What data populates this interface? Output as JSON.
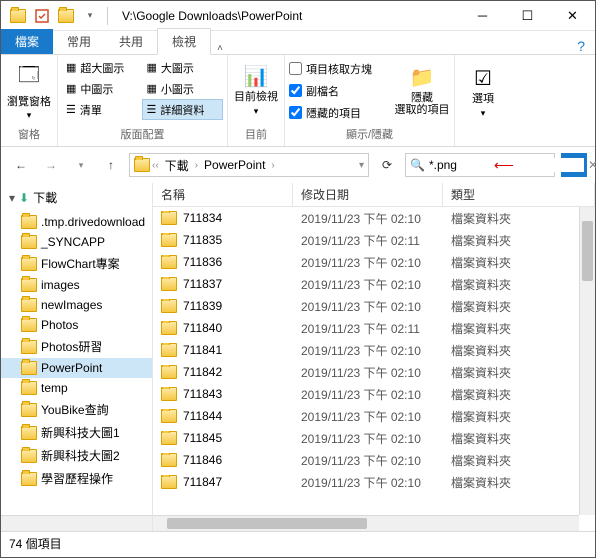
{
  "title": "V:\\Google Downloads\\PowerPoint",
  "tabs": {
    "file": "檔案",
    "home": "常用",
    "share": "共用",
    "view": "檢視"
  },
  "ribbon": {
    "panes": {
      "nav_pane": "瀏覽窗格",
      "group": "窗格"
    },
    "layout": {
      "extra_large": "超大圖示",
      "large": "大圖示",
      "medium": "中圖示",
      "small": "小圖示",
      "list": "清單",
      "details": "詳細資料",
      "group": "版面配置"
    },
    "current_view": {
      "sort": "目前檢視",
      "group": "目前"
    },
    "show_hide": {
      "item_check": "項目核取方塊",
      "ext": "副檔名",
      "hidden": "隱藏的項目",
      "hide_btn": "隱藏",
      "hide_btn2": "選取的項目",
      "group": "顯示/隱藏"
    },
    "options": {
      "label": "選項"
    }
  },
  "breadcrumb": {
    "item1": "下載",
    "item2": "PowerPoint"
  },
  "search": {
    "placeholder": "",
    "value": "*.png"
  },
  "nav_header": "下載",
  "nav_items": [
    ".tmp.drivedownload",
    "_SYNCAPP",
    "FlowChart專案",
    "images",
    "newImages",
    "Photos",
    "Photos研習",
    "PowerPoint",
    "temp",
    "YouBike查詢",
    "新興科技大圖1",
    "新興科技大圖2",
    "學習歷程操作"
  ],
  "nav_selected": 7,
  "columns": {
    "name": "名稱",
    "date": "修改日期",
    "type": "類型"
  },
  "files": [
    {
      "name": "711834",
      "date": "2019/11/23 下午 02:10",
      "type": "檔案資料夾"
    },
    {
      "name": "711835",
      "date": "2019/11/23 下午 02:11",
      "type": "檔案資料夾"
    },
    {
      "name": "711836",
      "date": "2019/11/23 下午 02:10",
      "type": "檔案資料夾"
    },
    {
      "name": "711837",
      "date": "2019/11/23 下午 02:10",
      "type": "檔案資料夾"
    },
    {
      "name": "711839",
      "date": "2019/11/23 下午 02:10",
      "type": "檔案資料夾"
    },
    {
      "name": "711840",
      "date": "2019/11/23 下午 02:11",
      "type": "檔案資料夾"
    },
    {
      "name": "711841",
      "date": "2019/11/23 下午 02:10",
      "type": "檔案資料夾"
    },
    {
      "name": "711842",
      "date": "2019/11/23 下午 02:10",
      "type": "檔案資料夾"
    },
    {
      "name": "711843",
      "date": "2019/11/23 下午 02:10",
      "type": "檔案資料夾"
    },
    {
      "name": "711844",
      "date": "2019/11/23 下午 02:10",
      "type": "檔案資料夾"
    },
    {
      "name": "711845",
      "date": "2019/11/23 下午 02:10",
      "type": "檔案資料夾"
    },
    {
      "name": "711846",
      "date": "2019/11/23 下午 02:10",
      "type": "檔案資料夾"
    },
    {
      "name": "711847",
      "date": "2019/11/23 下午 02:10",
      "type": "檔案資料夾"
    }
  ],
  "status": "74 個項目"
}
